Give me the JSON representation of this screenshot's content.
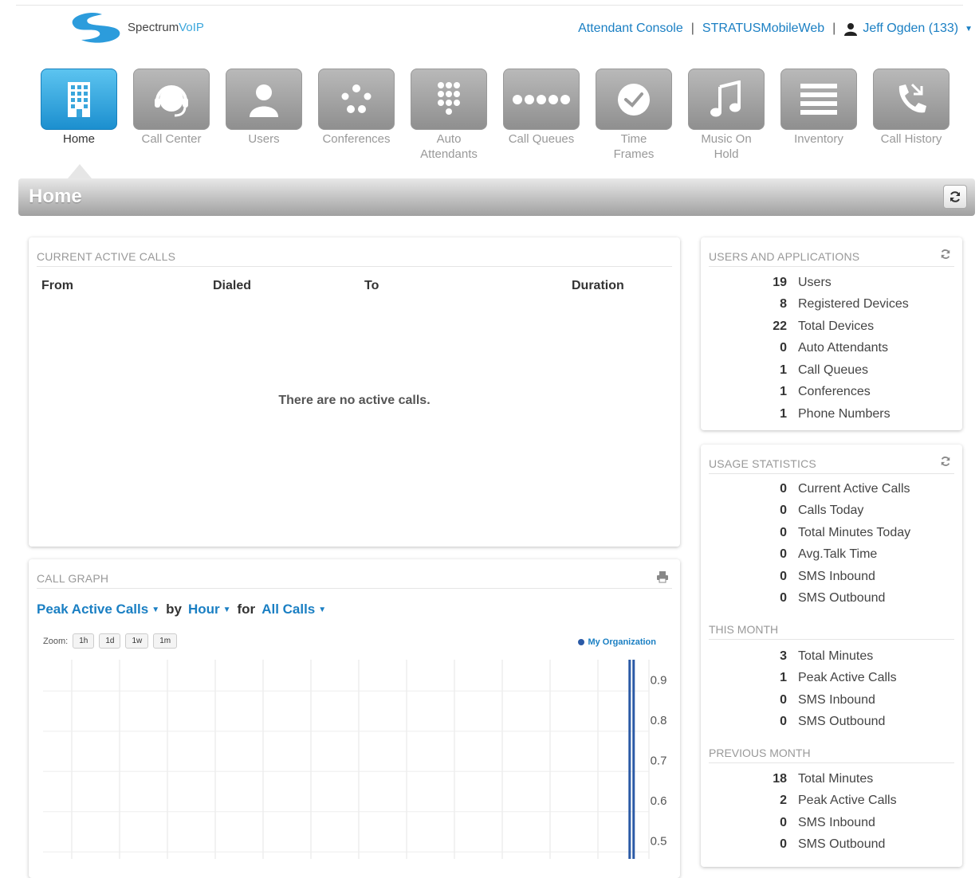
{
  "header": {
    "brand_name": "Spectrum",
    "brand_suffix": "VoIP",
    "links": {
      "attendant": "Attendant Console",
      "mobile": "STRATUSMobileWeb",
      "user": "Jeff Ogden (133)"
    },
    "separator": "|"
  },
  "nav": {
    "items": [
      {
        "label": "Home",
        "icon": "building-icon"
      },
      {
        "label": "Call Center",
        "icon": "headset-icon"
      },
      {
        "label": "Users",
        "icon": "user-icon"
      },
      {
        "label": "Conferences",
        "icon": "conference-icon"
      },
      {
        "label": "Auto\nAttendants",
        "icon": "keypad-icon"
      },
      {
        "label": "Call Queues",
        "icon": "queue-dots-icon"
      },
      {
        "label": "Time\nFrames",
        "icon": "clock-icon"
      },
      {
        "label": "Music On\nHold",
        "icon": "music-note-icon"
      },
      {
        "label": "Inventory",
        "icon": "list-icon"
      },
      {
        "label": "Call History",
        "icon": "call-history-icon"
      }
    ]
  },
  "page": {
    "title": "Home"
  },
  "active_calls": {
    "title": "CURRENT ACTIVE CALLS",
    "columns": {
      "from": "From",
      "dialed": "Dialed",
      "to": "To",
      "duration": "Duration"
    },
    "empty_message": "There are no active calls."
  },
  "call_graph": {
    "title": "CALL GRAPH",
    "metric": "Peak Active Calls",
    "by_label": "by",
    "period": "Hour",
    "for_label": "for",
    "filter": "All Calls",
    "zoom_label": "Zoom:",
    "zoom_options": [
      "1h",
      "1d",
      "1w",
      "1m"
    ],
    "legend": "My Organization"
  },
  "chart_data": {
    "type": "line",
    "series": [
      {
        "name": "My Organization",
        "values": [
          0,
          0,
          0,
          0,
          0,
          0,
          0,
          0,
          0,
          0,
          0,
          0,
          0,
          1,
          0
        ]
      }
    ],
    "y_ticks": [
      "0.9",
      "0.8",
      "0.7",
      "0.6",
      "0.5"
    ],
    "ylim": [
      0.5,
      0.9
    ],
    "grid": true,
    "line_color": "#2b5aa6"
  },
  "users_apps": {
    "title": "USERS AND APPLICATIONS",
    "stats": [
      {
        "value": "19",
        "label": "Users"
      },
      {
        "value": "8",
        "label": "Registered Devices"
      },
      {
        "value": "22",
        "label": "Total Devices"
      },
      {
        "value": "0",
        "label": "Auto Attendants"
      },
      {
        "value": "1",
        "label": "Call Queues"
      },
      {
        "value": "1",
        "label": "Conferences"
      },
      {
        "value": "1",
        "label": "Phone Numbers"
      }
    ]
  },
  "usage": {
    "title": "USAGE STATISTICS",
    "today": [
      {
        "value": "0",
        "label": "Current Active Calls"
      },
      {
        "value": "0",
        "label": "Calls Today"
      },
      {
        "value": "0",
        "label": "Total Minutes Today"
      },
      {
        "value": "0",
        "label": "Avg.Talk Time"
      },
      {
        "value": "0",
        "label": "SMS Inbound"
      },
      {
        "value": "0",
        "label": "SMS Outbound"
      }
    ],
    "this_month_title": "THIS MONTH",
    "this_month": [
      {
        "value": "3",
        "label": "Total Minutes"
      },
      {
        "value": "1",
        "label": "Peak Active Calls"
      },
      {
        "value": "0",
        "label": "SMS Inbound"
      },
      {
        "value": "0",
        "label": "SMS Outbound"
      }
    ],
    "previous_month_title": "PREVIOUS MONTH",
    "previous_month": [
      {
        "value": "18",
        "label": "Total Minutes"
      },
      {
        "value": "2",
        "label": "Peak Active Calls"
      },
      {
        "value": "0",
        "label": "SMS Inbound"
      },
      {
        "value": "0",
        "label": "SMS Outbound"
      }
    ]
  },
  "colors": {
    "accent": "#1a7fc3",
    "active_tile": "#1c8fcf",
    "tile": "#9a9a9a"
  }
}
